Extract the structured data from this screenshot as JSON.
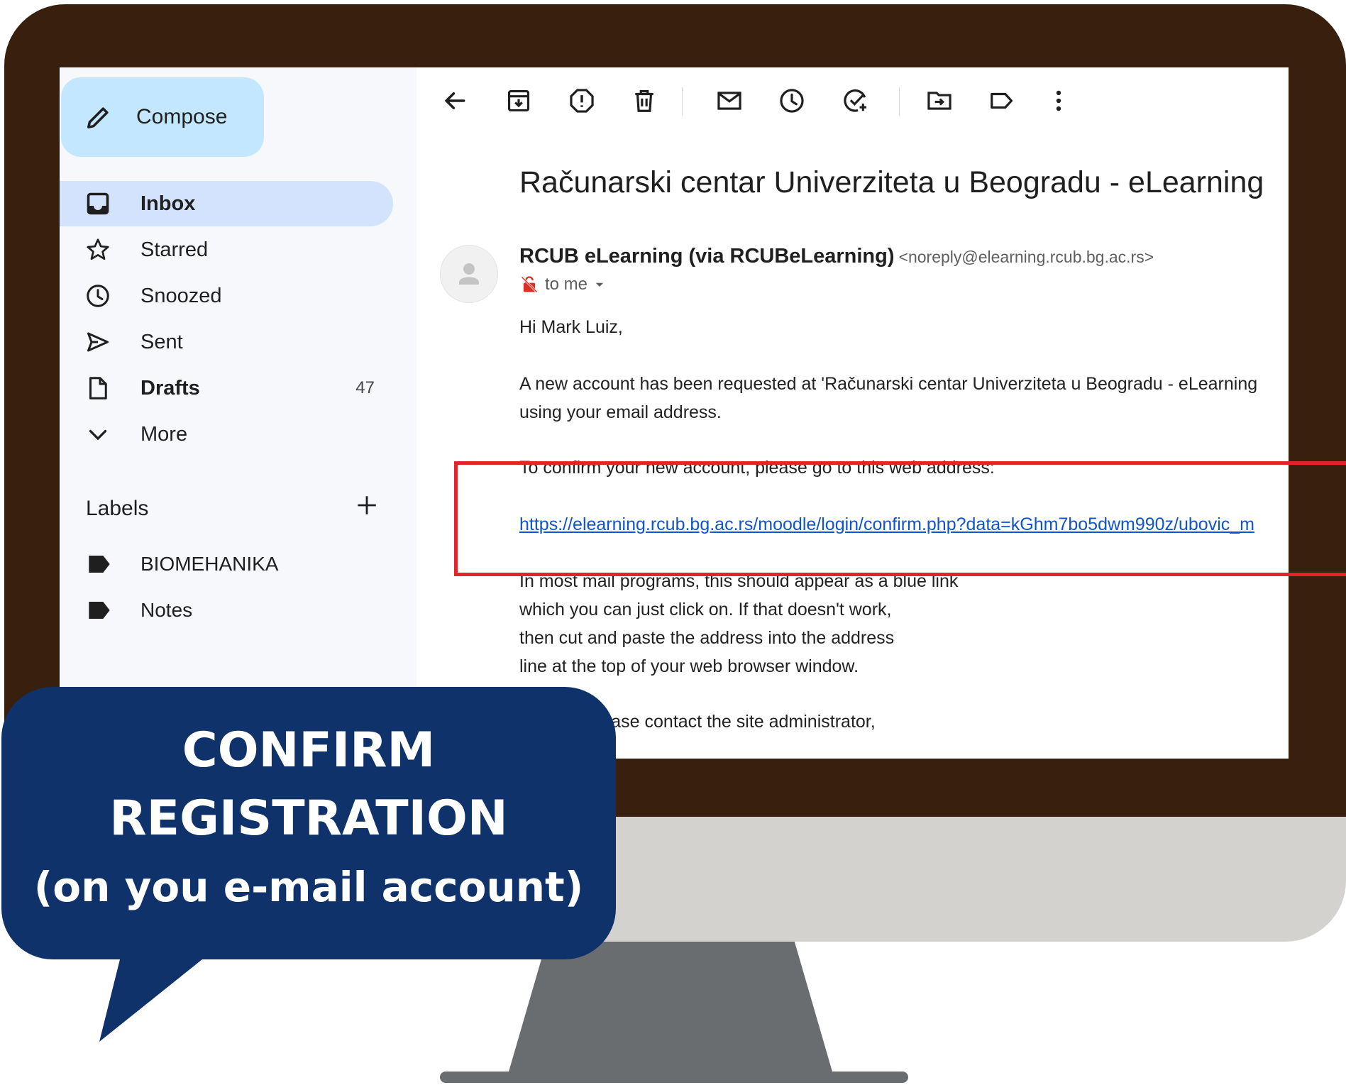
{
  "compose": {
    "label": "Compose"
  },
  "nav": [
    {
      "label": "Inbox",
      "icon": "inbox-icon",
      "active": true,
      "bold": true,
      "count": ""
    },
    {
      "label": "Starred",
      "icon": "star-icon",
      "active": false,
      "bold": false,
      "count": ""
    },
    {
      "label": "Snoozed",
      "icon": "clock-icon",
      "active": false,
      "bold": false,
      "count": ""
    },
    {
      "label": "Sent",
      "icon": "send-icon",
      "active": false,
      "bold": false,
      "count": ""
    },
    {
      "label": "Drafts",
      "icon": "draft-icon",
      "active": false,
      "bold": true,
      "count": "47"
    },
    {
      "label": "More",
      "icon": "chevron-down-icon",
      "active": false,
      "bold": false,
      "count": ""
    }
  ],
  "labels": {
    "title": "Labels",
    "items": [
      {
        "label": "BIOMEHANIKA",
        "icon": "label-icon"
      },
      {
        "label": "Notes",
        "icon": "label-icon"
      }
    ]
  },
  "toolbar": {
    "icons": [
      "back-arrow-icon",
      "archive-icon",
      "report-spam-icon",
      "delete-icon",
      "mark-unread-icon",
      "snooze-icon",
      "add-task-icon",
      "move-to-icon",
      "label-icon",
      "more-vert-icon"
    ]
  },
  "email": {
    "subject": "Računarski centar Univerziteta u Beogradu - eLearning",
    "sender_name": "RCUB eLearning (via RCUBeLearning)",
    "sender_email": "<noreply@elearning.rcub.bg.ac.rs>",
    "to": "to me",
    "greeting": "Hi Mark Luiz,",
    "body1_line1": "A new account has been requested at 'Računarski centar Univerziteta u Beogradu - eLearning",
    "body1_line2": "using your email address.",
    "confirm_text": "To confirm your new account, please go to this web address:",
    "confirm_link": "https://elearning.rcub.bg.ac.rs/moodle/login/confirm.php?data=kGhm7bo5dwm990z/ubovic_m",
    "body2_line1": "In most mail programs, this should appear as a blue link",
    "body2_line2": "which you can just click on. If that doesn't work,",
    "body2_line3": "then cut and paste the address into the address",
    "body2_line4": "line at the top of your web browser window.",
    "body3_line1": "ed help, please contact the site administrator,"
  },
  "callout": {
    "line1": "CONFIRM",
    "line2": "REGISTRATION",
    "line3": "(on you e-mail account)"
  },
  "colors": {
    "bezel": "#381f0e",
    "chin": "#d3d2ce",
    "stand": "#6a6d70",
    "bubble": "#0f326b",
    "highlight": "#e0262a",
    "compose_bg": "#c2e7ff",
    "nav_active_bg": "#d3e3fd"
  }
}
